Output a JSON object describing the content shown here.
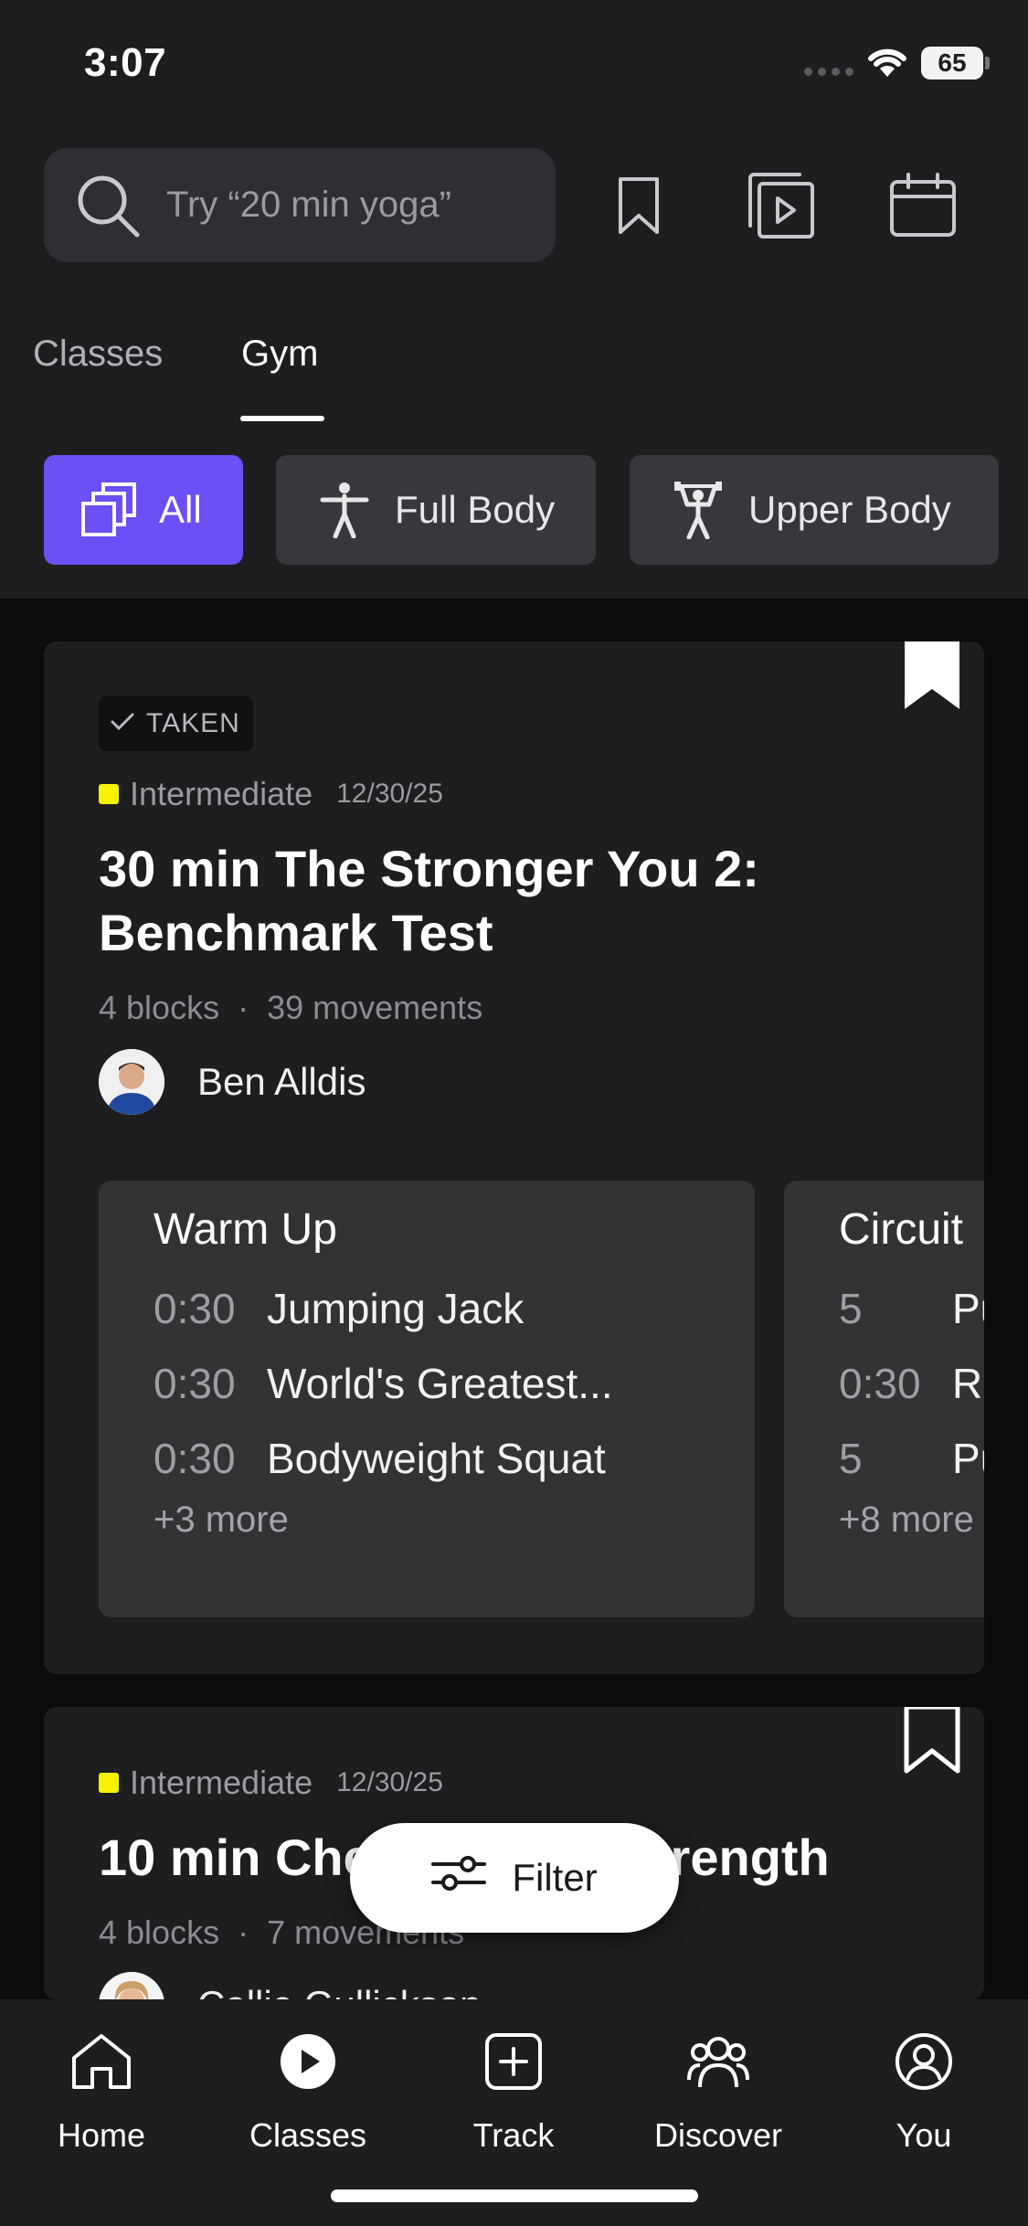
{
  "status": {
    "time": "3:07",
    "battery": "65"
  },
  "search": {
    "placeholder": "Try “20 min yoga”"
  },
  "tabs": [
    {
      "label": "Classes"
    },
    {
      "label": "Gym"
    }
  ],
  "chips": [
    {
      "label": "All"
    },
    {
      "label": "Full Body"
    },
    {
      "label": "Upper Body"
    }
  ],
  "cards": [
    {
      "badge": "TAKEN",
      "level": "Intermediate",
      "date": "12/30/25",
      "title": "30 min The Stronger You 2: Benchmark Test",
      "blocks_count": "4 blocks",
      "separator": "·",
      "movements_count": "39 movements",
      "instructor": "Ben Alldis",
      "blocks": [
        {
          "name": "Warm Up",
          "rows": [
            {
              "time": "0:30",
              "move": "Jumping Jack"
            },
            {
              "time": "0:30",
              "move": "World's Greatest..."
            },
            {
              "time": "0:30",
              "move": "Bodyweight Squat"
            }
          ],
          "more": "+3 more"
        },
        {
          "name": "Circuit",
          "rows": [
            {
              "time": "5",
              "move": "Pu"
            },
            {
              "time": "0:30",
              "move": "Re"
            },
            {
              "time": "5",
              "move": "Pu"
            }
          ],
          "more": "+8 more"
        }
      ]
    },
    {
      "level": "Intermediate",
      "date": "12/30/25",
      "title": "10 min Chest & Back Strength",
      "blocks_count": "4 blocks",
      "separator": "·",
      "movements_count": "7 movements",
      "instructor": "Callie Gullickson"
    }
  ],
  "filter": {
    "label": "Filter"
  },
  "nav": [
    {
      "label": "Home",
      "icon": "home-icon"
    },
    {
      "label": "Classes",
      "icon": "play-circle-icon"
    },
    {
      "label": "Track",
      "icon": "plus-square-icon"
    },
    {
      "label": "Discover",
      "icon": "people-icon"
    },
    {
      "label": "You",
      "icon": "profile-icon"
    }
  ],
  "colors": {
    "accent": "#6c4ff6",
    "level": "#f5f200",
    "surface": "#1e1e21",
    "block": "#333336"
  }
}
